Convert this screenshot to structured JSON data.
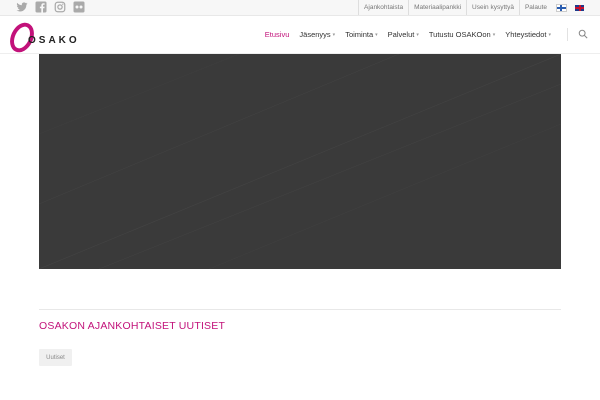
{
  "colors": {
    "accent": "#c2127a",
    "hero_bg": "#3a3a3a",
    "topbar_bg": "#f7f7f7"
  },
  "social": [
    {
      "name": "twitter-icon"
    },
    {
      "name": "facebook-icon"
    },
    {
      "name": "instagram-icon"
    },
    {
      "name": "flickr-icon"
    }
  ],
  "toplinks": [
    "Ajankohtaista",
    "Materiaalipankki",
    "Usein kysyttyä",
    "Palaute"
  ],
  "languages": [
    "fi",
    "en"
  ],
  "logo": {
    "text": "OSAKO"
  },
  "nav": [
    {
      "label": "Etusivu",
      "active": true,
      "dropdown": false
    },
    {
      "label": "Jäsenyys",
      "active": false,
      "dropdown": true
    },
    {
      "label": "Toiminta",
      "active": false,
      "dropdown": true
    },
    {
      "label": "Palvelut",
      "active": false,
      "dropdown": true
    },
    {
      "label": "Tutustu OSAKOon",
      "active": false,
      "dropdown": true
    },
    {
      "label": "Yhteystiedot",
      "active": false,
      "dropdown": true
    }
  ],
  "news": {
    "title": "OSAKON AJANKOHTAISET UUTISET",
    "tag": "Uutiset"
  }
}
